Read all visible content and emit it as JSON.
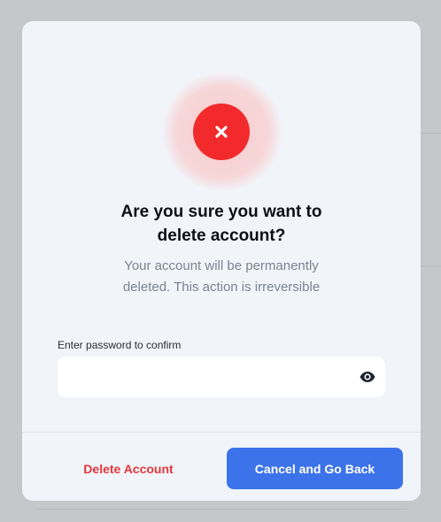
{
  "dialog": {
    "title_line1": "Are you sure you want to",
    "title_line2": "delete account?",
    "message_line1": "Your account will be permanently",
    "message_line2": "deleted. This action is irreversible",
    "icon": "close-x-icon",
    "colors": {
      "danger": "#f22a2c",
      "primary": "#3d73ea",
      "background": "#f1f4f9"
    }
  },
  "password": {
    "label": "Enter password to confirm",
    "value": "",
    "placeholder": "",
    "toggle_icon": "eye-icon"
  },
  "actions": {
    "delete_label": "Delete Account",
    "cancel_label": "Cancel and Go Back"
  }
}
